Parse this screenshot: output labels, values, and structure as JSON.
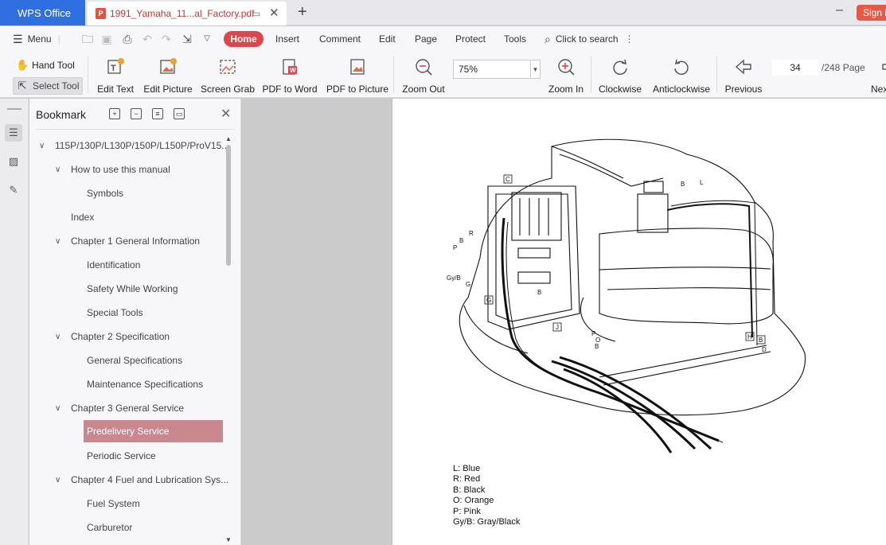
{
  "tabs": {
    "app": "WPS Office",
    "doc_title": "1991_Yamaha_11...al_Factory.pdf",
    "signin": "Sign in"
  },
  "menu": {
    "menu_label": "Menu",
    "home": "Home",
    "items": [
      "Insert",
      "Comment",
      "Edit",
      "Page",
      "Protect",
      "Tools"
    ],
    "search_placeholder": "Click to search"
  },
  "ribbon": {
    "hand_tool": "Hand Tool",
    "select_tool": "Select Tool",
    "buttons": {
      "edit_text": "Edit Text",
      "edit_picture": "Edit Picture",
      "screen_grab": "Screen Grab",
      "pdf_to_word": "PDF to Word",
      "pdf_to_picture": "PDF to Picture",
      "zoom_out": "Zoom Out",
      "zoom_in": "Zoom In",
      "clockwise": "Clockwise",
      "anticlockwise": "Anticlockwise",
      "previous": "Previous",
      "next": "Next"
    },
    "zoom_value": "75%",
    "page_current": "34",
    "page_total": "/248 Page"
  },
  "bookmark": {
    "title": "Bookmark",
    "items": [
      {
        "label": "115P/130P/L130P/150P/L150P/ProV15...",
        "level": 0,
        "expanded": true
      },
      {
        "label": "How to use this manual",
        "level": 1,
        "expanded": true
      },
      {
        "label": "Symbols",
        "level": 2
      },
      {
        "label": "Index",
        "level": 1
      },
      {
        "label": "Chapter 1 General Information",
        "level": 1,
        "expanded": true
      },
      {
        "label": "Identification",
        "level": 2
      },
      {
        "label": "Safety While Working",
        "level": 2
      },
      {
        "label": "Special Tools",
        "level": 2
      },
      {
        "label": "Chapter 2 Specification",
        "level": 1,
        "expanded": true
      },
      {
        "label": "General Specifications",
        "level": 2
      },
      {
        "label": "Maintenance Specifications",
        "level": 2
      },
      {
        "label": "Chapter 3 General Service",
        "level": 1,
        "expanded": true
      },
      {
        "label": "Predelivery Service",
        "level": 2,
        "selected": true
      },
      {
        "label": "Periodic Service",
        "level": 2
      },
      {
        "label": "Chapter 4 Fuel and Lubrication Sys...",
        "level": 1,
        "expanded": true
      },
      {
        "label": "Fuel System",
        "level": 2
      },
      {
        "label": "Carburetor",
        "level": 2
      }
    ]
  },
  "document": {
    "diagram_labels": {
      "C": "C",
      "R": "R",
      "B": "B",
      "P": "P",
      "GyB": "Gy/B",
      "G": "G",
      "Gbox": "G",
      "B2": "B",
      "J": "J",
      "P2": "P",
      "O": "O",
      "B3": "B",
      "Btop": "B",
      "Ltop": "L",
      "H": "H",
      "Bbox": "B",
      "D": "D"
    },
    "legend": [
      "L: Blue",
      "R: Red",
      "B: Black",
      "O: Orange",
      "P: Pink",
      "Gy/B: Gray/Black"
    ]
  }
}
